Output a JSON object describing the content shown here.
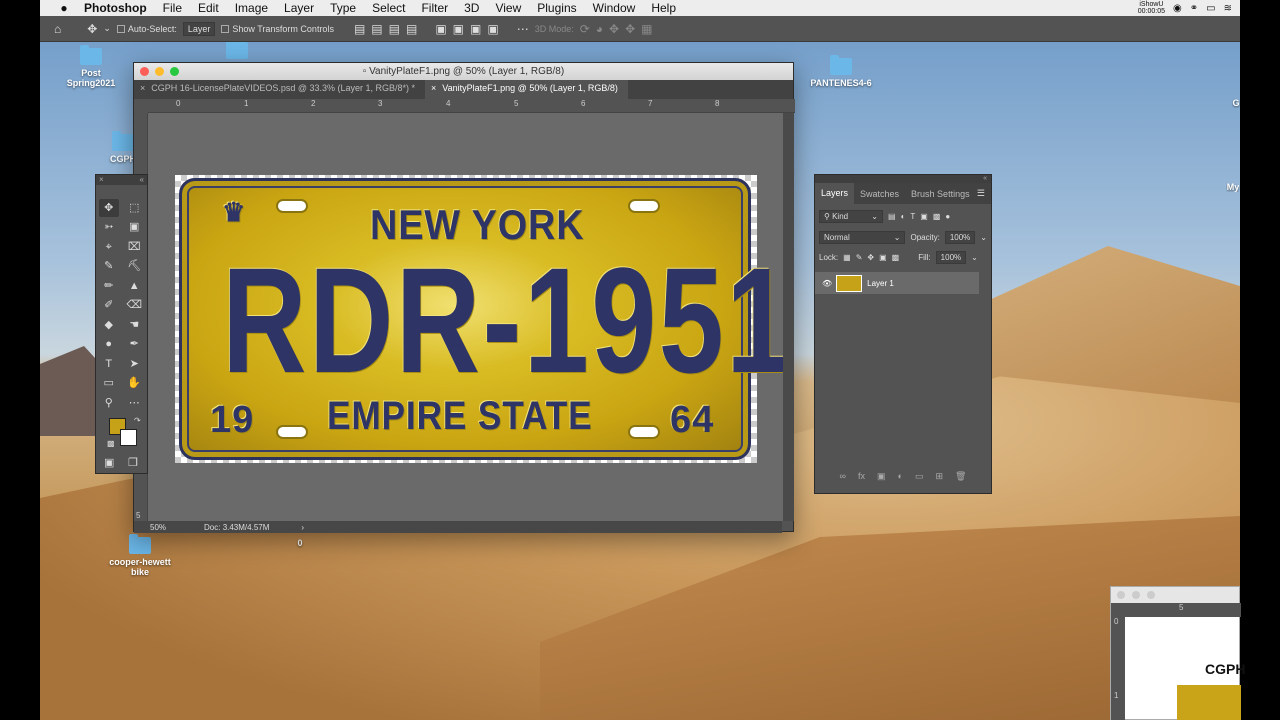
{
  "menubar": {
    "app": "Photoshop",
    "items": [
      "File",
      "Edit",
      "Image",
      "Layer",
      "Type",
      "Select",
      "Filter",
      "3D",
      "View",
      "Plugins",
      "Window",
      "Help"
    ],
    "recorder": "iShowU",
    "recorder_time": "00:00:05"
  },
  "options": {
    "auto_select_label": "Auto-Select:",
    "auto_select_value": "Layer",
    "transform_label": "Show Transform Controls",
    "mode_3d": "3D Mode:"
  },
  "desktop": {
    "icons": [
      "Post Spring2021",
      "PANTENES4-6",
      "cooper-hewett bike",
      "CGPH",
      "G",
      "My"
    ],
    "partial_label": "0"
  },
  "document": {
    "title": "VanityPlateF1.png @ 50% (Layer 1, RGB/8)",
    "tabs": [
      {
        "label": "CGPH  16-LicensePlateVIDEOS.psd @ 33.3% (Layer 1, RGB/8*) *"
      },
      {
        "label": "VanityPlateF1.png @ 50% (Layer 1, RGB/8)"
      }
    ],
    "ruler_h": [
      "0",
      "1",
      "2",
      "3",
      "4",
      "5",
      "6",
      "7",
      "8"
    ],
    "ruler_v": [
      "5"
    ],
    "zoom": "50%",
    "doc_size": "Doc: 3.43M/4.57M"
  },
  "plate": {
    "top": "NEW YORK",
    "main": "RDR-1951",
    "left": "19",
    "bottom": "EMPIRE STATE",
    "right": "64"
  },
  "layers_panel": {
    "tabs": [
      "Layers",
      "Swatches",
      "Brush Settings"
    ],
    "filter": "Kind",
    "blend_mode": "Normal",
    "opacity_label": "Opacity:",
    "opacity": "100%",
    "lock_label": "Lock:",
    "fill_label": "Fill:",
    "fill": "100%",
    "layer_name": "Layer 1"
  },
  "win2": {
    "ruler": "5",
    "vr0": "0",
    "vr1": "1",
    "logo": "CGPH"
  },
  "colors": {
    "foreground": "#c5a218",
    "background": "#ffffff"
  }
}
